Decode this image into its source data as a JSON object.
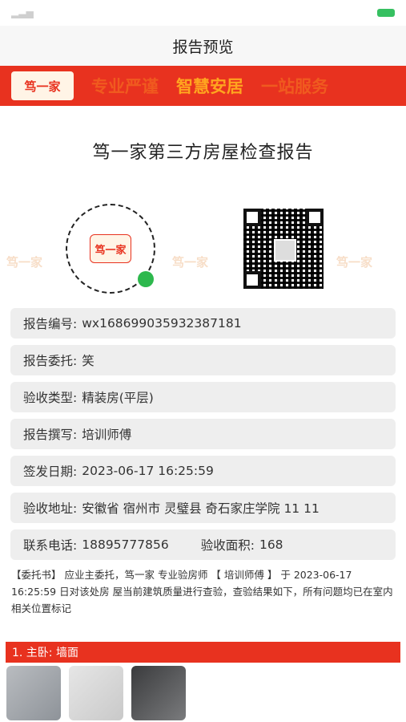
{
  "navbar": {
    "title": "报告预览"
  },
  "banner": {
    "logo": "笃一家",
    "slogans": [
      "专业严谨",
      "智慧安居",
      "一站服务"
    ]
  },
  "report_title": "笃一家第三方房屋检查报告",
  "watermark": "笃一家",
  "qr": {
    "mini_center": "笃一家"
  },
  "info": {
    "rows": [
      {
        "label": "报告编号:",
        "value": "wx16869903593238718​1"
      },
      {
        "label": "报告委托:",
        "value": "笑"
      },
      {
        "label": "验收类型:",
        "value": "精装房(平层)"
      },
      {
        "label": "报告撰写:",
        "value": "培训师傅"
      },
      {
        "label": "签发日期:",
        "value": "2023-06-17 16:25:59"
      },
      {
        "label": "验收地址:",
        "value": "安徽省 宿州市 灵璧县 奇石家庄学院 11 11"
      }
    ],
    "phone_label": "联系电话:",
    "phone": "18895777856",
    "area_label": "验收面积:",
    "area": "168"
  },
  "intro": "【委托书】 应业主委托，笃一家 专业验房师 【 培训师傅 】 于 2023-06-17 16:25:59 日对该处房 屋当前建筑质量进行查验，查验结果如下，所有问题均已在室内相关位置标记",
  "section": {
    "title": "1. 主卧: 墙面"
  }
}
